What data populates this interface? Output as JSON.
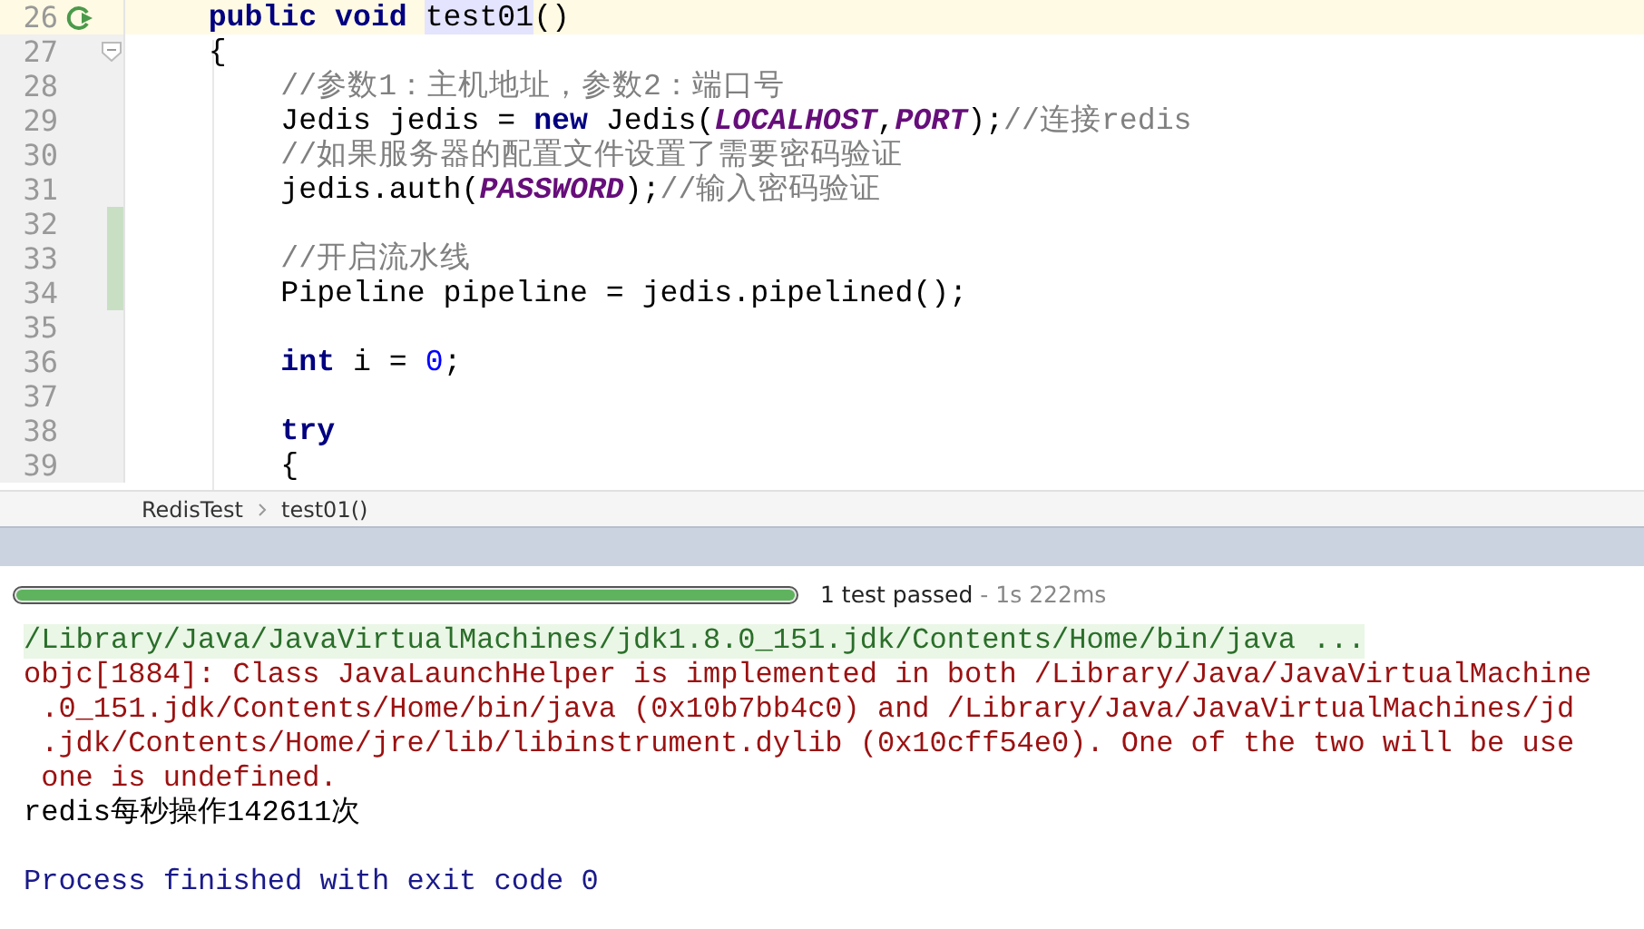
{
  "editor": {
    "lines": [
      {
        "number": "26",
        "current": true,
        "run_icon": true,
        "fold": false,
        "changed": false,
        "tokens": [
          {
            "kind": "keyword",
            "text": "    public"
          },
          {
            "kind": "keyword",
            "text": " void "
          },
          {
            "kind": "usage",
            "text": "test01"
          },
          {
            "kind": "plain",
            "text": "()"
          }
        ]
      },
      {
        "number": "27",
        "current": false,
        "run_icon": false,
        "fold": true,
        "changed": false,
        "tokens": [
          {
            "kind": "plain",
            "text": "    {"
          }
        ]
      },
      {
        "number": "28",
        "current": false,
        "run_icon": false,
        "fold": false,
        "changed": false,
        "tokens": [
          {
            "kind": "comment",
            "text": "        //参数1：主机地址，参数2：端口号"
          }
        ]
      },
      {
        "number": "29",
        "current": false,
        "run_icon": false,
        "fold": false,
        "changed": false,
        "tokens": [
          {
            "kind": "plain",
            "text": "        Jedis jedis = "
          },
          {
            "kind": "keyword",
            "text": "new"
          },
          {
            "kind": "plain",
            "text": " Jedis("
          },
          {
            "kind": "constant",
            "text": "LOCALHOST"
          },
          {
            "kind": "plain",
            "text": ","
          },
          {
            "kind": "constant",
            "text": "PORT"
          },
          {
            "kind": "plain",
            "text": ");"
          },
          {
            "kind": "comment",
            "text": "//连接redis"
          }
        ]
      },
      {
        "number": "30",
        "current": false,
        "run_icon": false,
        "fold": false,
        "changed": false,
        "tokens": [
          {
            "kind": "comment",
            "text": "        //如果服务器的配置文件设置了需要密码验证"
          }
        ]
      },
      {
        "number": "31",
        "current": false,
        "run_icon": false,
        "fold": false,
        "changed": false,
        "tokens": [
          {
            "kind": "plain",
            "text": "        jedis.auth("
          },
          {
            "kind": "constant",
            "text": "PASSWORD"
          },
          {
            "kind": "plain",
            "text": ");"
          },
          {
            "kind": "comment",
            "text": "//输入密码验证"
          }
        ]
      },
      {
        "number": "32",
        "current": false,
        "run_icon": false,
        "fold": false,
        "changed": true
      },
      {
        "number": "33",
        "current": false,
        "run_icon": false,
        "fold": false,
        "changed": true,
        "tokens": [
          {
            "kind": "comment",
            "text": "        //开启流水线"
          }
        ]
      },
      {
        "number": "34",
        "current": false,
        "run_icon": false,
        "fold": false,
        "changed": true,
        "tokens": [
          {
            "kind": "plain",
            "text": "        Pipeline pipeline = jedis.pipelined();"
          }
        ]
      },
      {
        "number": "35",
        "current": false,
        "run_icon": false,
        "fold": false,
        "changed": false
      },
      {
        "number": "36",
        "current": false,
        "run_icon": false,
        "fold": false,
        "changed": false,
        "tokens": [
          {
            "kind": "keyword",
            "text": "        int"
          },
          {
            "kind": "plain",
            "text": " i = "
          },
          {
            "kind": "number",
            "text": "0"
          },
          {
            "kind": "plain",
            "text": ";"
          }
        ]
      },
      {
        "number": "37",
        "current": false,
        "run_icon": false,
        "fold": false,
        "changed": false
      },
      {
        "number": "38",
        "current": false,
        "run_icon": false,
        "fold": false,
        "changed": false,
        "tokens": [
          {
            "kind": "keyword",
            "text": "        try"
          }
        ]
      },
      {
        "number": "39",
        "current": false,
        "run_icon": false,
        "fold": false,
        "changed": false,
        "tokens": [
          {
            "kind": "plain",
            "text": "        {"
          }
        ]
      }
    ]
  },
  "breadcrumb": [
    "RedisTest",
    "test01()"
  ],
  "test_status": {
    "level": 1,
    "result": "1 test passed",
    "duration": "- 1s 222ms"
  },
  "console": [
    {
      "kind": "command",
      "text": "/Library/Java/JavaVirtualMachines/jdk1.8.0_151.jdk/Contents/Home/bin/java ..."
    },
    {
      "kind": "error",
      "text": "objc[1884]: Class JavaLaunchHelper is implemented in both /Library/Java/JavaVirtualMachine"
    },
    {
      "kind": "error",
      "text": " .0_151.jdk/Contents/Home/bin/java (0x10b7bb4c0) and /Library/Java/JavaVirtualMachines/jd"
    },
    {
      "kind": "error",
      "text": " .jdk/Contents/Home/jre/lib/libinstrument.dylib (0x10cff54e0). One of the two will be use"
    },
    {
      "kind": "error",
      "text": " one is undefined."
    },
    {
      "kind": "output",
      "text": "redis每秒操作142611次"
    },
    {
      "kind": "blank"
    },
    {
      "kind": "exit",
      "text": "Process finished with exit code 0"
    }
  ]
}
